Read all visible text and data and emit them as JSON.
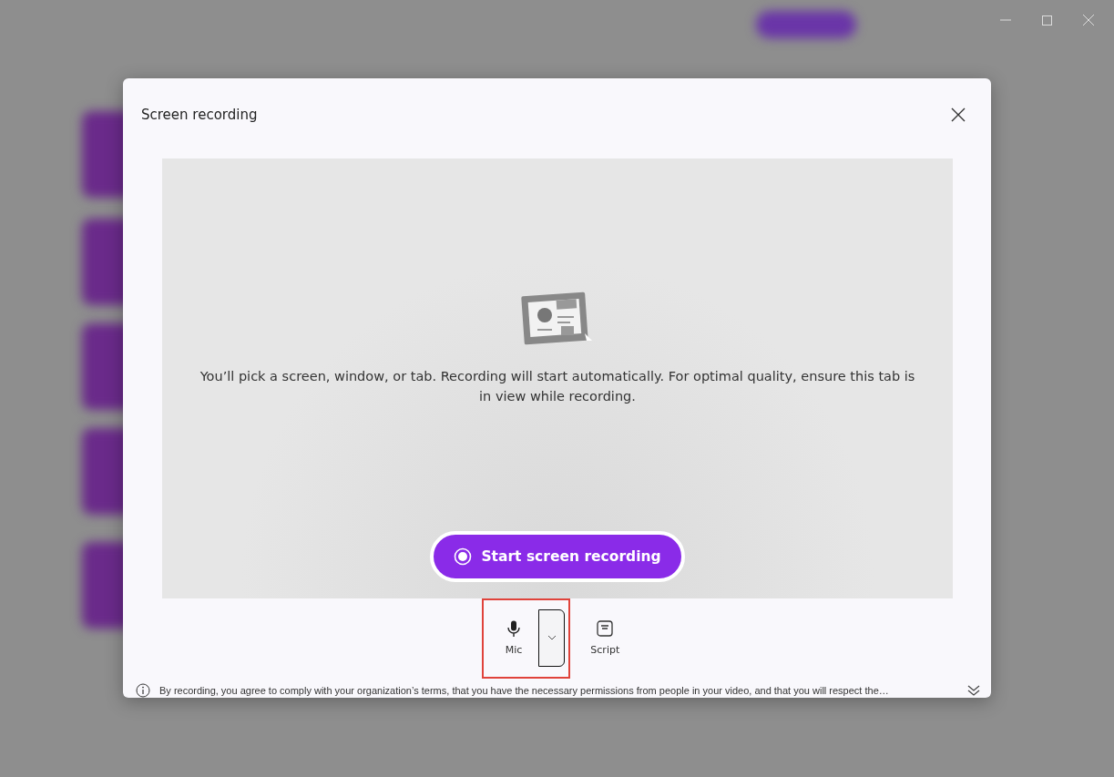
{
  "dialog": {
    "title": "Screen recording",
    "message": "You’ll pick a screen, window, or tab. Recording will start automatically. For optimal quality, ensure this tab is in view while recording.",
    "start_button": "Start screen recording",
    "tools": [
      {
        "kind": "mic",
        "label": "Mic"
      },
      {
        "kind": "script",
        "label": "Script"
      }
    ],
    "notice": "By recording, you agree to comply with your organization’s terms, that you have the necessary permissions from people in your video, and that you will respect the…"
  }
}
